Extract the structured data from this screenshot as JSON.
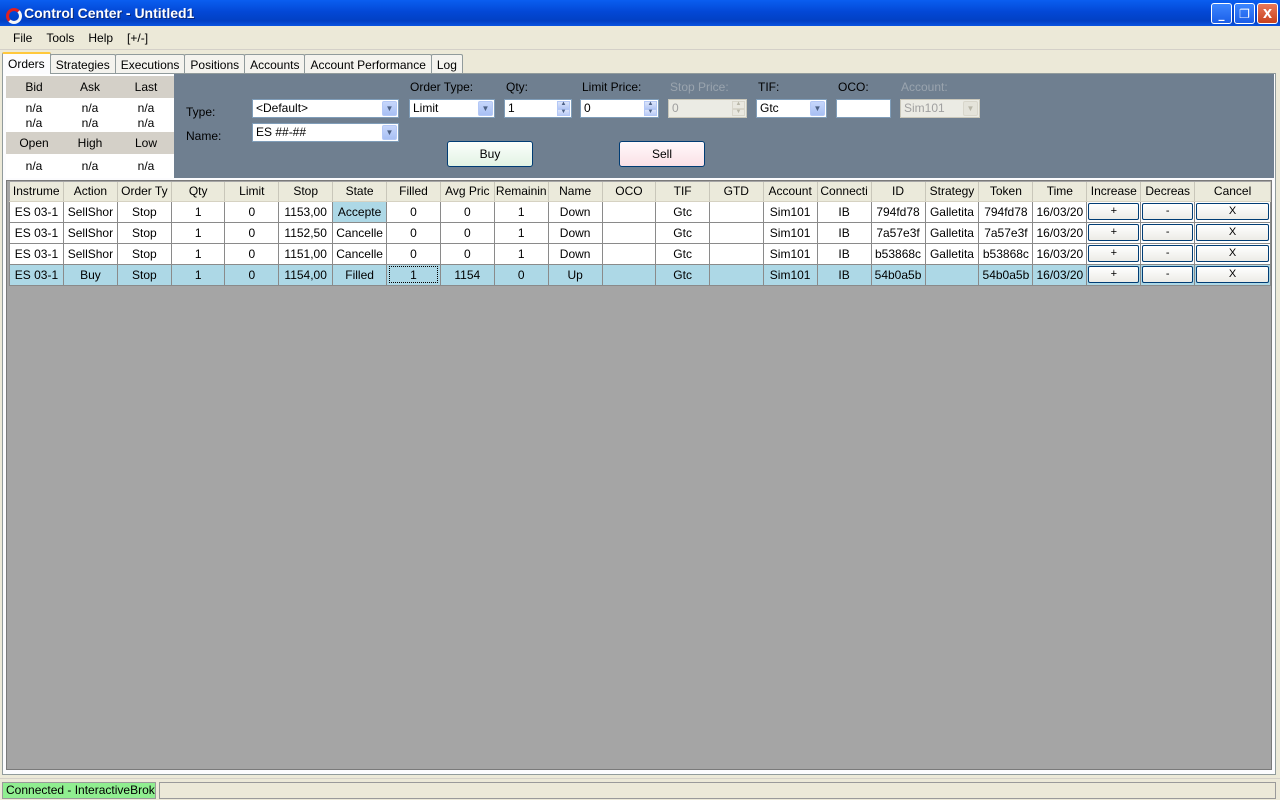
{
  "window": {
    "title": "Control Center - Untitled1",
    "minimize": "_",
    "maximize": "❐",
    "close": "X"
  },
  "menu": [
    "File",
    "Tools",
    "Help",
    "[+/-]"
  ],
  "tabs": [
    "Orders",
    "Strategies",
    "Executions",
    "Positions",
    "Accounts",
    "Account Performance",
    "Log"
  ],
  "quotes": {
    "headers1": [
      "Bid",
      "Ask",
      "Last"
    ],
    "values1a": [
      "n/a",
      "n/a",
      "n/a"
    ],
    "values1b": [
      "n/a",
      "n/a",
      "n/a"
    ],
    "headers2": [
      "Open",
      "High",
      "Low"
    ],
    "values2": [
      "n/a",
      "n/a",
      "n/a"
    ]
  },
  "entry": {
    "type_label": "Type:",
    "type_value": "<Default>",
    "name_label": "Name:",
    "name_value": "ES ##-##",
    "order_type_label": "Order Type:",
    "order_type_value": "Limit",
    "qty_label": "Qty:",
    "qty_value": "1",
    "limit_label": "Limit Price:",
    "limit_value": "0",
    "stop_label": "Stop Price:",
    "stop_value": "0",
    "tif_label": "TIF:",
    "tif_value": "Gtc",
    "oco_label": "OCO:",
    "oco_value": "",
    "account_label": "Account:",
    "account_value": "Sim101",
    "buy": "Buy",
    "sell": "Sell"
  },
  "grid": {
    "columns": [
      "Instrume",
      "Action",
      "Order Ty",
      "Qty",
      "Limit",
      "Stop",
      "State",
      "Filled",
      "Avg Pric",
      "Remainin",
      "Name",
      "OCO",
      "TIF",
      "GTD",
      "Account",
      "Connecti",
      "ID",
      "Strategy",
      "Token",
      "Time",
      "Increase",
      "Decreas",
      "Cancel"
    ],
    "rows": [
      [
        "ES 03-1",
        "SellShor",
        "Stop",
        "1",
        "0",
        "1153,00",
        "Accepte",
        "0",
        "0",
        "1",
        "Down",
        "",
        "Gtc",
        "",
        "Sim101",
        "IB",
        "794fd78",
        "Galletita",
        "794fd78",
        "16/03/20",
        "+",
        "-",
        "X"
      ],
      [
        "ES 03-1",
        "SellShor",
        "Stop",
        "1",
        "0",
        "1152,50",
        "Cancelle",
        "0",
        "0",
        "1",
        "Down",
        "",
        "Gtc",
        "",
        "Sim101",
        "IB",
        "7a57e3f",
        "Galletita",
        "7a57e3f",
        "16/03/20",
        "+",
        "-",
        "X"
      ],
      [
        "ES 03-1",
        "SellShor",
        "Stop",
        "1",
        "0",
        "1151,00",
        "Cancelle",
        "0",
        "0",
        "1",
        "Down",
        "",
        "Gtc",
        "",
        "Sim101",
        "IB",
        "b53868c",
        "Galletita",
        "b53868c",
        "16/03/20",
        "+",
        "-",
        "X"
      ],
      [
        "ES 03-1",
        "Buy",
        "Stop",
        "1",
        "0",
        "1154,00",
        "Filled",
        "1",
        "1154",
        "0",
        "Up",
        "",
        "Gtc",
        "",
        "Sim101",
        "IB",
        "54b0a5b",
        "",
        "54b0a5b",
        "16/03/20",
        "+",
        "-",
        "X"
      ]
    ]
  },
  "status": {
    "connection": "Connected - InteractiveBrokers",
    "connection_color": "#90ee90"
  }
}
